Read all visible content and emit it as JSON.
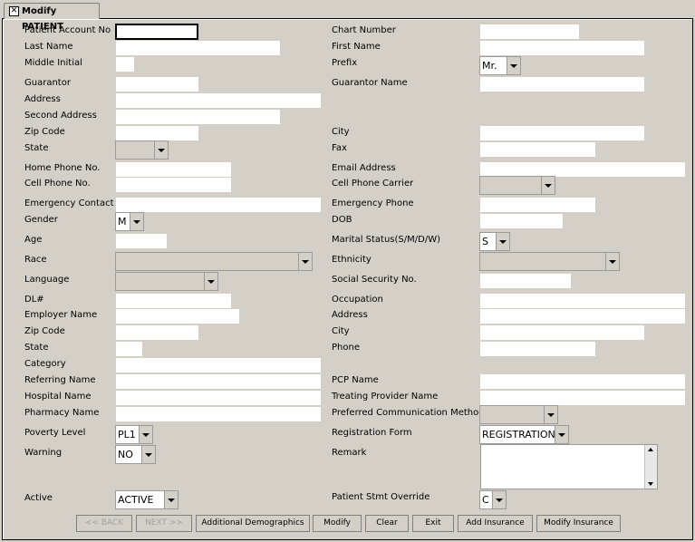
{
  "tab_title": "Modify PATIENT",
  "labels": {
    "patient_account_no": "Patient Account No",
    "chart_number": "Chart Number",
    "last_name": "Last Name",
    "first_name": "First Name",
    "middle_initial": "Middle Initial",
    "prefix": "Prefix",
    "guarantor": "Guarantor",
    "guarantor_name": "Guarantor Name",
    "address": "Address",
    "second_address": "Second Address",
    "zip_code": "Zip Code",
    "city": "City",
    "state": "State",
    "fax": "Fax",
    "home_phone": "Home Phone No.",
    "email": "Email Address",
    "cell_phone": "Cell Phone No.",
    "cell_phone_carrier": "Cell Phone Carrier",
    "emergency_contact": "Emergency Contact",
    "emergency_phone": "Emergency Phone",
    "gender": "Gender",
    "dob": "DOB",
    "age": "Age",
    "marital_status": "Marital Status(S/M/D/W)",
    "race": "Race",
    "ethnicity": "Ethnicity",
    "language": "Language",
    "ssn": "Social Security No.",
    "dl": "DL#",
    "occupation": "Occupation",
    "employer_name": "Employer Name",
    "emp_address": "Address",
    "emp_zip": "Zip Code",
    "emp_city": "City",
    "emp_state": "State",
    "emp_phone": "Phone",
    "category": "Category",
    "referring_name": "Referring Name",
    "pcp_name": "PCP Name",
    "hospital_name": "Hospital Name",
    "treating_provider": "Treating Provider Name",
    "pharmacy_name": "Pharmacy Name",
    "pref_comm": "Preferred Communication Method",
    "poverty_level": "Poverty Level",
    "registration_form": "Registration Form",
    "warning": "Warning",
    "remark": "Remark",
    "active": "Active",
    "stmt_override": "Patient Stmt Override"
  },
  "values": {
    "prefix": "Mr.",
    "gender": "M",
    "marital_status": "S",
    "poverty_level": "PL1",
    "registration_form": "REGISTRATION",
    "warning": "NO",
    "active": "ACTIVE",
    "stmt_override": "C"
  },
  "buttons": {
    "back": "<< BACK",
    "next": "NEXT >>",
    "additional_demographics": "Additional Demographics",
    "modify": "Modify",
    "clear": "Clear",
    "exit": "Exit",
    "add_insurance": "Add Insurance",
    "modify_insurance": "Modify Insurance"
  }
}
